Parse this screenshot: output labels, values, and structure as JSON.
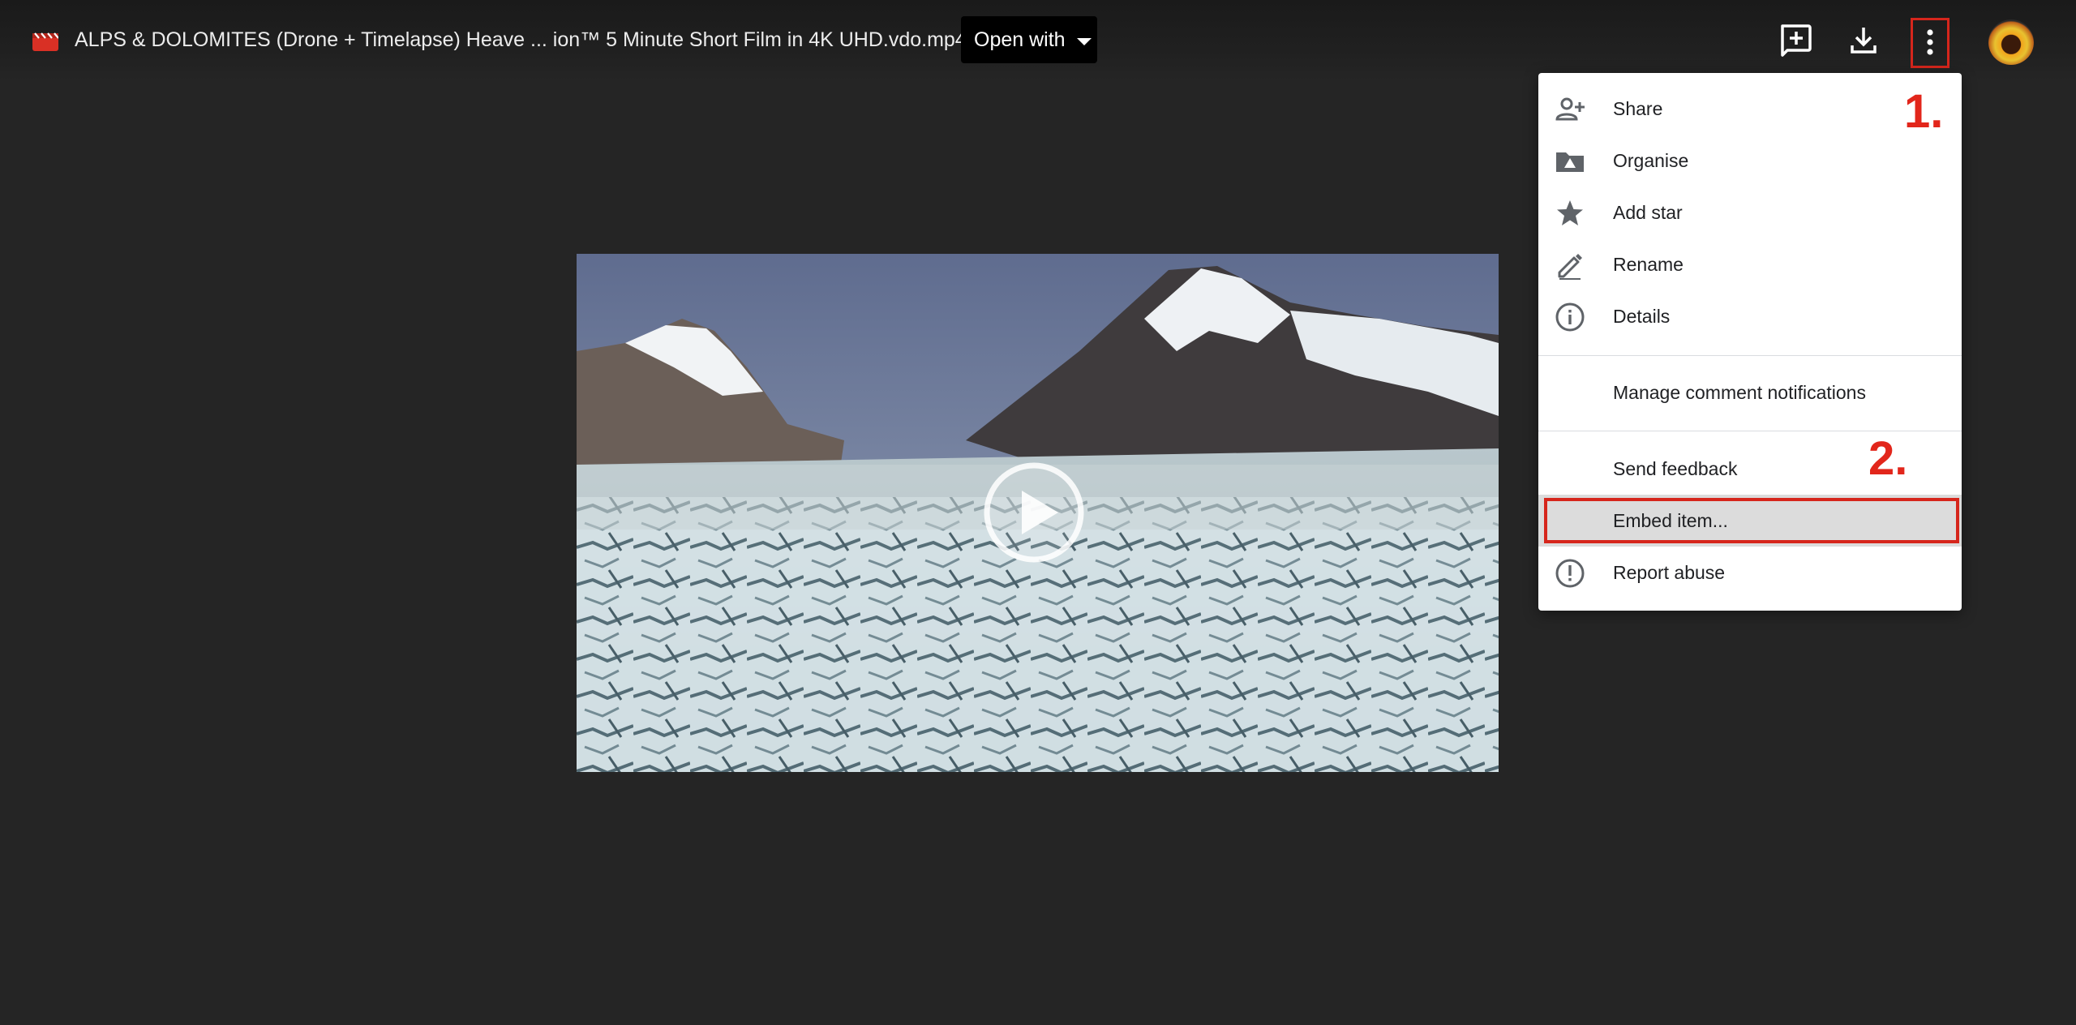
{
  "header": {
    "file_icon": "video-file-icon",
    "file_title": "ALPS & DOLOMITES (Drone + Timelapse) Heave ... ion™ 5 Minute Short Film in 4K UHD.vdo.mp4",
    "open_with_label": "Open with",
    "icons": [
      "add-comment-icon",
      "download-icon",
      "more-vert-icon",
      "avatar"
    ]
  },
  "video": {
    "play_icon": "play-icon"
  },
  "menu": {
    "items": [
      {
        "label": "Share",
        "icon": "person-add-icon"
      },
      {
        "label": "Organise",
        "icon": "drive-folder-icon"
      },
      {
        "label": "Add star",
        "icon": "star-icon"
      },
      {
        "label": "Rename",
        "icon": "edit-pencil-icon"
      },
      {
        "label": "Details",
        "icon": "info-icon"
      },
      {
        "label": "Manage comment notifications",
        "icon": ""
      },
      {
        "label": "Send feedback",
        "icon": ""
      },
      {
        "label": "Embed item...",
        "icon": ""
      },
      {
        "label": "Report abuse",
        "icon": "report-icon"
      }
    ],
    "highlighted_item": "Embed item..."
  },
  "annotations": {
    "step1": "1.",
    "step2": "2.",
    "color": "#d6261c"
  }
}
